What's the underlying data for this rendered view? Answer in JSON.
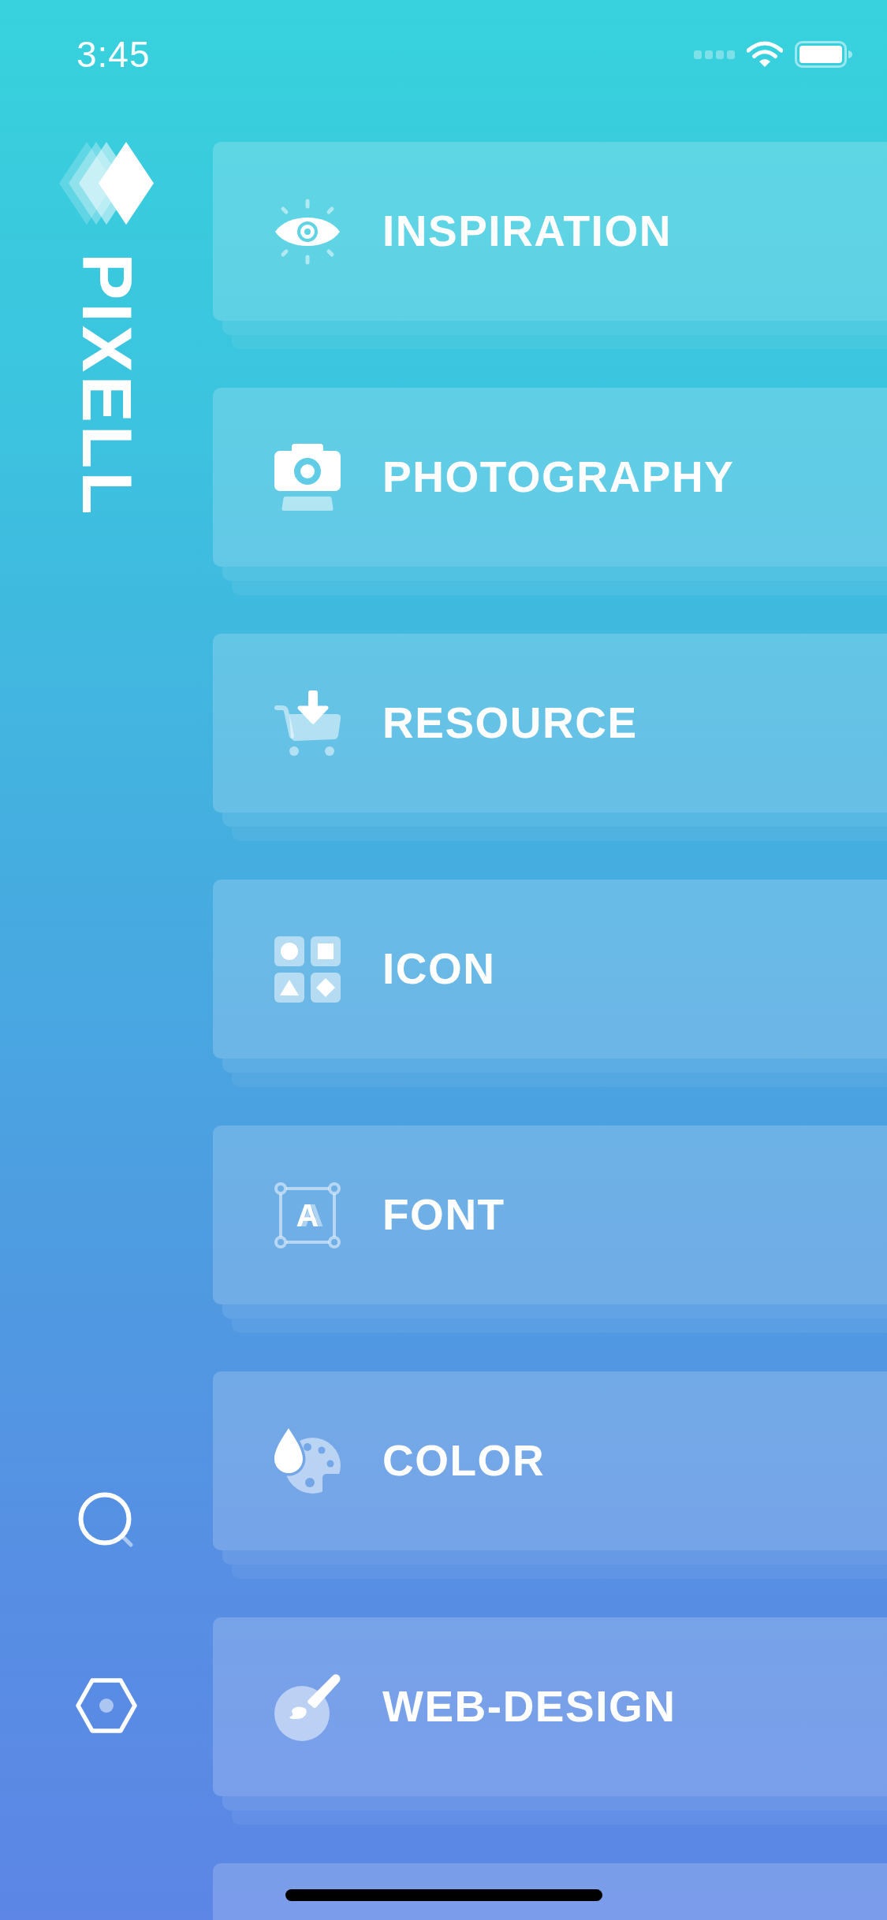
{
  "status_bar": {
    "time": "3:45"
  },
  "sidebar": {
    "wordmark": "PIXELL"
  },
  "categories": [
    {
      "label": "INSPIRATION"
    },
    {
      "label": "PHOTOGRAPHY"
    },
    {
      "label": "RESOURCE"
    },
    {
      "label": "ICON"
    },
    {
      "label": "FONT",
      "glyph": "A"
    },
    {
      "label": "COLOR"
    },
    {
      "label": "WEB-DESIGN"
    }
  ]
}
